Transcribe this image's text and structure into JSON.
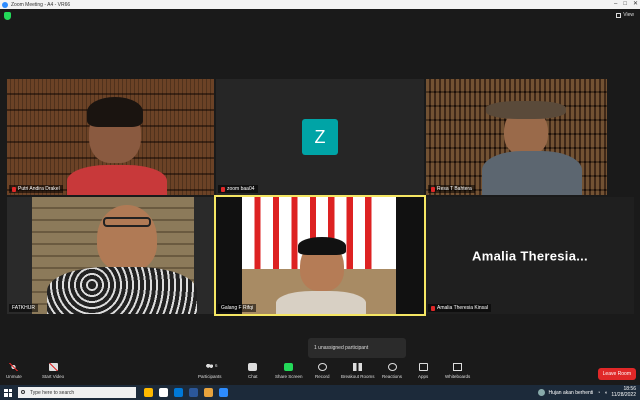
{
  "window": {
    "title": "Zoom Meeting - A4 - VR66"
  },
  "topbar": {
    "view_label": "View"
  },
  "participants": [
    {
      "name": "Putri Andira Drakel",
      "muted": true
    },
    {
      "name": "zoom baa04",
      "muted": true,
      "avatar_letter": "Z"
    },
    {
      "name": "Resa T Bahtera",
      "muted": true
    },
    {
      "name": "FATKHUR",
      "muted": false
    },
    {
      "name": "Galang F Rifqi",
      "muted": true
    },
    {
      "name": "Amalia Theresia Kinsal",
      "muted": true,
      "display_text": "Amalia  Theresia..."
    }
  ],
  "toast": "1 unassigned participant",
  "toolbar": {
    "unmute": "Unmute",
    "start_video": "Start Video",
    "participants": "Participants",
    "participants_count": "6",
    "chat": "Chat",
    "share_screen": "Share Screen",
    "record": "Record",
    "breakout_rooms": "Breakout Rooms",
    "reactions": "Reactions",
    "apps": "Apps",
    "whiteboards": "Whiteboards",
    "leave": "Leave Room"
  },
  "taskbar": {
    "search_placeholder": "Type here to search",
    "weather": "Hujan akan berhenti",
    "time": "18:56",
    "date": "11/28/2022"
  },
  "colors": {
    "accent": "#2d8cff",
    "active_speaker": "#f5e663",
    "leave": "#e02828",
    "avatar": "#00a4a6"
  }
}
